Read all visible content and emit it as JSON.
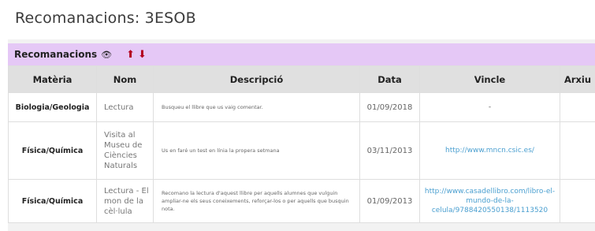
{
  "page": {
    "title": "Recomanacions: 3ESOB"
  },
  "panel": {
    "title": "Recomanacions",
    "icons": {
      "eye": "eye-icon",
      "up": "arrow-up-icon",
      "down": "arrow-down-icon"
    },
    "colors": {
      "header_bg": "#e5c8f6",
      "arrow": "#b3001e",
      "link": "#4a9fd0"
    }
  },
  "table": {
    "headers": [
      "Matèria",
      "Nom",
      "Descripció",
      "Data",
      "Vincle",
      "Arxiu"
    ],
    "rows": [
      {
        "materia": "Biologia/Geologia",
        "nom": "Lectura",
        "descripcio": "Busqueu el llibre que us vaig comentar.",
        "data": "01/09/2018",
        "vincle": "-",
        "arxiu": ""
      },
      {
        "materia": "Física/Química",
        "nom": "Visita al Museu de Ciències Naturals",
        "descripcio": "Us en faré un test en línia la propera setmana",
        "data": "03/11/2013",
        "vincle": "http://www.mncn.csic.es/",
        "arxiu": ""
      },
      {
        "materia": "Física/Química",
        "nom": "Lectura - El mon de la cèl·lula",
        "descripcio": "Recomano la lectura d'aquest llibre per aquells alumnes que vulguin ampliar-ne els seus coneixements, reforçar-los o per aquells que busquin nota.",
        "data": "01/09/2013",
        "vincle": "http://www.casadellibro.com/libro-el-mundo-de-la-celula/9788420550138/1113520",
        "arxiu": ""
      }
    ]
  }
}
